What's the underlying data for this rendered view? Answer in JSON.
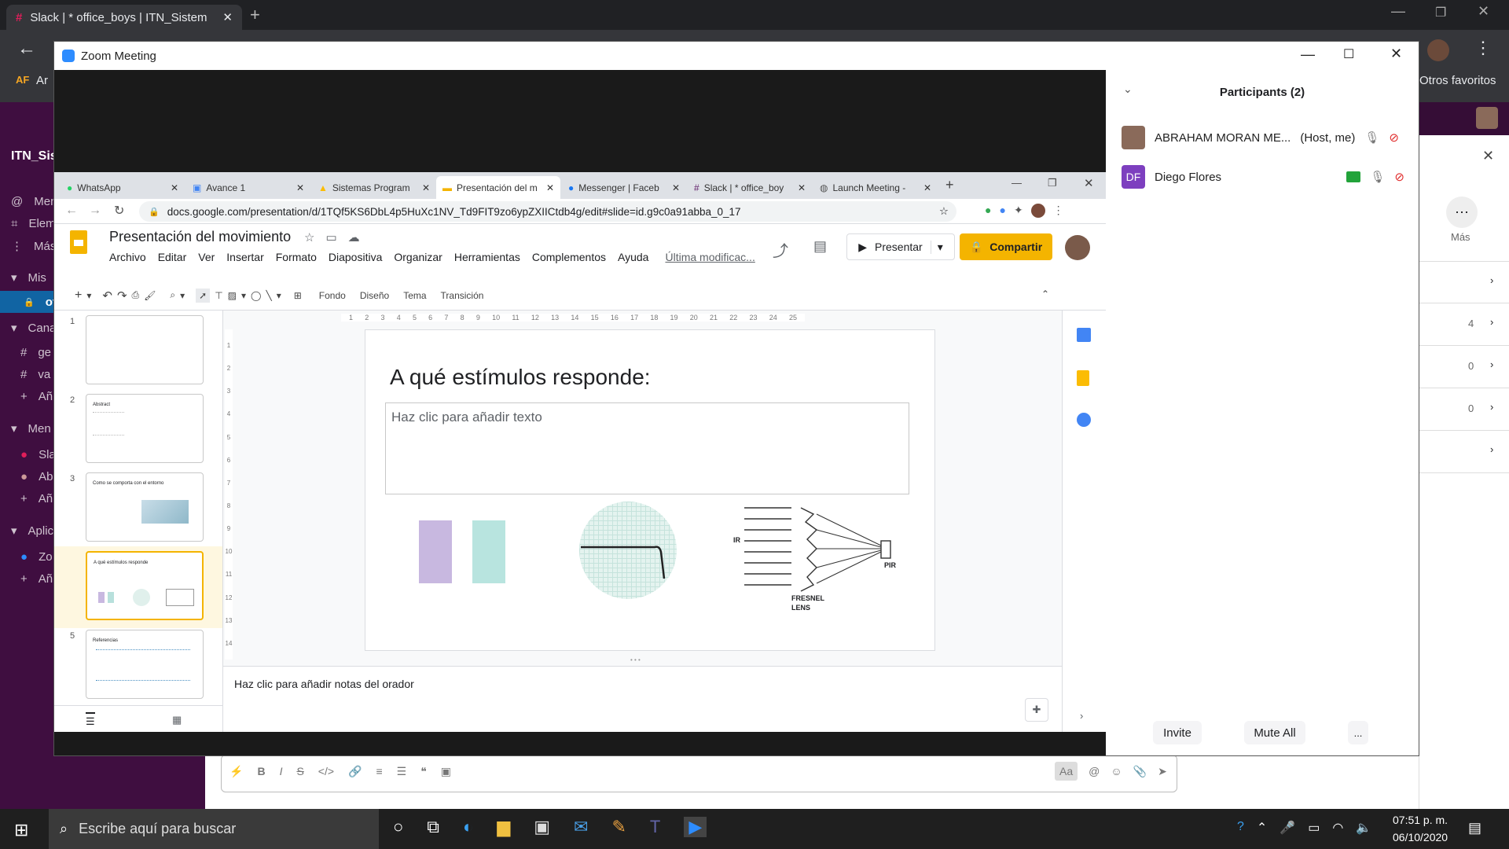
{
  "outer_browser": {
    "tab_title": "Slack | * office_boys | ITN_Sistem",
    "bookmark_left": "Ar",
    "bookmark_right": "Otros favoritos",
    "bookmark_left_badge": "AF"
  },
  "slack": {
    "workspace": "ITN_Sis",
    "sidebar": [
      {
        "icon": "@",
        "label": "Men"
      },
      {
        "icon": "⌗",
        "label": "Elem"
      },
      {
        "icon": "⋮",
        "label": "Más"
      },
      {
        "icon": "▾",
        "label": "Mis"
      },
      {
        "icon": "🔒",
        "label": "of"
      },
      {
        "icon": "▾",
        "label": "Cana"
      },
      {
        "icon": "#",
        "label": "ge"
      },
      {
        "icon": "#",
        "label": "va"
      },
      {
        "icon": "+",
        "label": "Añ"
      },
      {
        "icon": "▾",
        "label": "Men"
      },
      {
        "icon": "●",
        "label": "Sla"
      },
      {
        "icon": "●",
        "label": "Ab"
      },
      {
        "icon": "+",
        "label": "Añ"
      },
      {
        "icon": "▾",
        "label": "Aplic"
      },
      {
        "icon": "●",
        "label": "Zo"
      },
      {
        "icon": "+",
        "label": "Añ"
      }
    ],
    "right_more_label": "Más",
    "right_counts": [
      "4",
      "0",
      "0"
    ]
  },
  "zoom": {
    "title": "Zoom Meeting",
    "participants_title": "Participants (2)",
    "participants": [
      {
        "name": "ABRAHAM MORAN ME...",
        "role": "(Host, me)",
        "initials": ""
      },
      {
        "name": "Diego Flores",
        "role": "",
        "initials": "DF"
      }
    ],
    "invite": "Invite",
    "mute_all": "Mute All",
    "more": "..."
  },
  "chrome": {
    "tabs": [
      "WhatsApp",
      "Avance 1",
      "Sistemas Program",
      "Presentación del m",
      "Messenger | Faceb",
      "Slack | * office_boy",
      "Launch Meeting -"
    ],
    "url": "docs.google.com/presentation/d/1TQf5KS6DbL4p5HuXc1NV_Td9FIT9zo6ypZXIICtdb4g/edit#slide=id.g9c0a91abba_0_17"
  },
  "slides": {
    "doc_title": "Presentación del movimiento",
    "menu": [
      "Archivo",
      "Editar",
      "Ver",
      "Insertar",
      "Formato",
      "Diapositiva",
      "Organizar",
      "Herramientas",
      "Complementos",
      "Ayuda"
    ],
    "last_modified": "Última modificac...",
    "present": "Presentar",
    "share": "Compartir",
    "toolbar": {
      "fondo": "Fondo",
      "diseno": "Diseño",
      "tema": "Tema",
      "transicion": "Transición"
    },
    "ruler": [
      "1",
      "2",
      "3",
      "4",
      "5",
      "6",
      "7",
      "8",
      "9",
      "10",
      "11",
      "12",
      "13",
      "14",
      "15",
      "16",
      "17",
      "18",
      "19",
      "20",
      "21",
      "22",
      "23",
      "24",
      "25"
    ],
    "vruler": [
      "1",
      "2",
      "3",
      "4",
      "5",
      "6",
      "7",
      "8",
      "9",
      "10",
      "11",
      "12",
      "13",
      "14"
    ],
    "slide_numbers": [
      "1",
      "2",
      "3",
      "4",
      "5"
    ],
    "thumb2_title": "Abstract",
    "thumb3_title": "Como se comporta con el entorno",
    "thumb4_title": "A qué estímulos responde",
    "thumb5_title": "Referencias",
    "slide_title": "A qué estímulos responde:",
    "body_placeholder": "Haz clic para añadir texto",
    "ir_label": "IR",
    "fresnel_label_1": "FRESNEL",
    "fresnel_label_2": "LENS",
    "pir_label": "PIR",
    "notes_placeholder": "Haz clic para añadir notas del orador"
  },
  "taskbar": {
    "search": "Escribe aquí para buscar",
    "time": "07:51 p. m.",
    "date": "06/10/2020"
  }
}
